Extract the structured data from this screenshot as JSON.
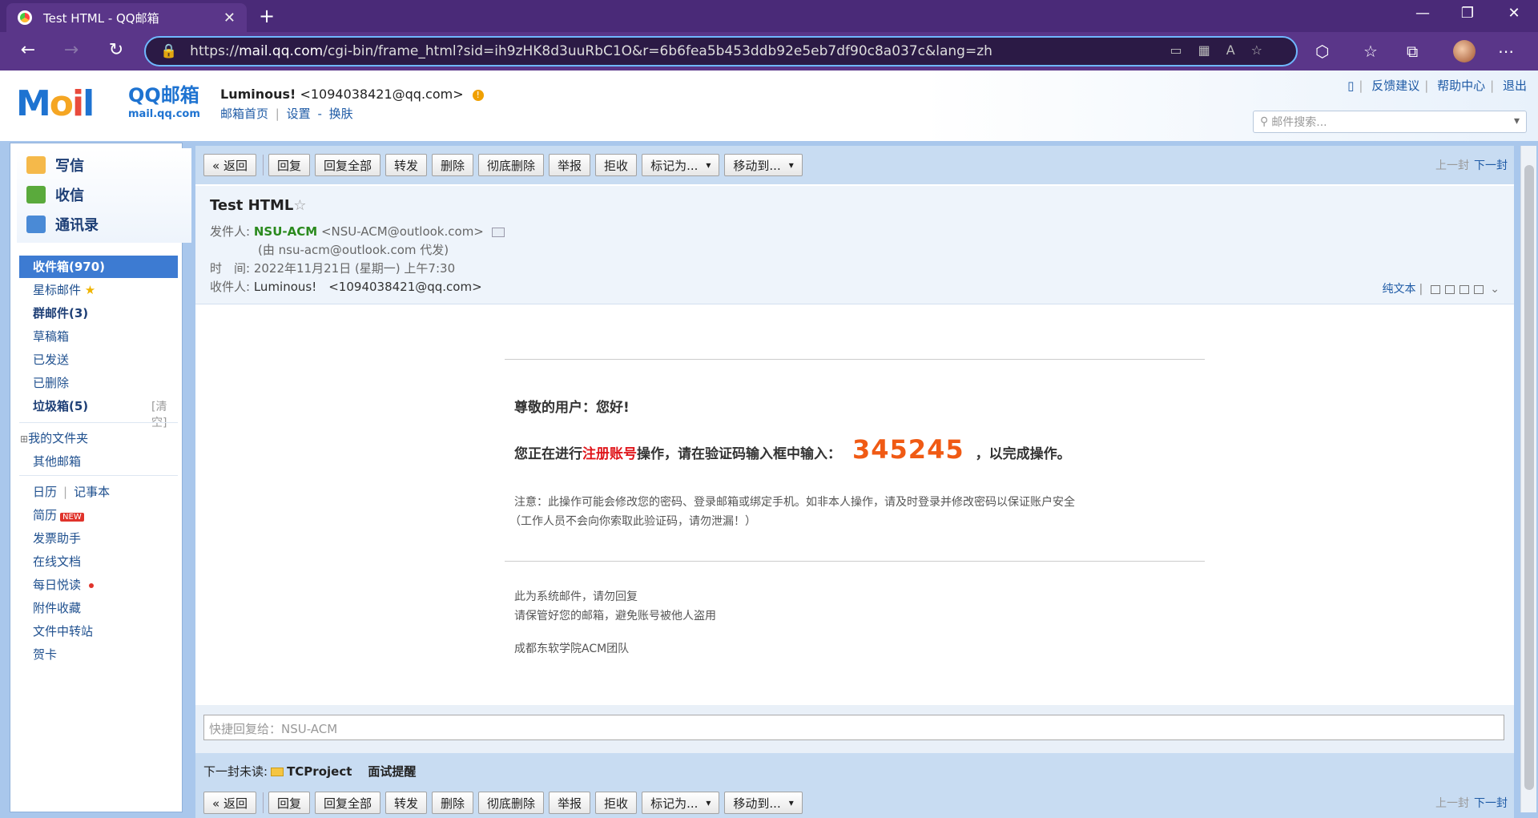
{
  "browser": {
    "tab_title": "Test HTML - QQ邮箱",
    "url_prefix": "https://",
    "url_host": "mail.qq.com",
    "url_path": "/cgi-bin/frame_html?sid=ih9zHK8d3uuRbC1O&r=6b6fea5b453ddb92e5eb7df90c8a037c&lang=zh"
  },
  "header": {
    "logo_text": "QQ邮箱",
    "logo_sub": "mail.qq.com",
    "user_name": "Luminous!",
    "user_email": "<1094038421@qq.com>",
    "links": [
      "邮箱首页",
      "|",
      "设置",
      "-",
      "换肤"
    ],
    "top_links": [
      "反馈建议",
      "帮助中心",
      "退出"
    ],
    "search_placeholder": "邮件搜索..."
  },
  "sidebar": {
    "compose": "写信",
    "inbox_main": "收信",
    "contacts": "通讯录",
    "inbox": "收件箱(970)",
    "starred": "星标邮件",
    "group": "群邮件(3)",
    "drafts": "草稿箱",
    "sent": "已发送",
    "deleted": "已删除",
    "spam": "垃圾箱(5)",
    "spam_clear": "[清空]",
    "my_folders": "我的文件夹",
    "other_mail": "其他邮箱",
    "calendar": "日历",
    "notebook": "记事本",
    "resume": "简历",
    "resume_badge": "NEW",
    "invoice": "发票助手",
    "docs": "在线文档",
    "daily": "每日悦读",
    "attachments": "附件收藏",
    "file_transfer": "文件中转站",
    "cards": "贺卡"
  },
  "toolbar": {
    "back": "« 返回",
    "reply": "回复",
    "reply_all": "回复全部",
    "forward": "转发",
    "delete": "删除",
    "delete_perm": "彻底删除",
    "report": "举报",
    "reject": "拒收",
    "mark_as": "标记为...",
    "move_to": "移动到...",
    "prev": "上一封",
    "next": "下一封"
  },
  "mail": {
    "subject": "Test HTML",
    "from_label": "发件人:",
    "from_name": "NSU-ACM",
    "from_email": "<NSU-ACM@outlook.com>",
    "sent_by": "(由 nsu-acm@outlook.com 代发)",
    "time_label": "时　间:",
    "time_value": "2022年11月21日 (星期一) 上午7:30",
    "to_label": "收件人:",
    "to_value": "Luminous!　<1094038421@qq.com>",
    "plain_text": "纯文本"
  },
  "body": {
    "greeting": "尊敬的用户：您好!",
    "line_pre": "您正在进行",
    "line_red": "注册账号",
    "line_mid": "操作，请在验证码输入框中输入：",
    "code": "345245",
    "line_post": "，以完成操作。",
    "note1": "注意：此操作可能会修改您的密码、登录邮箱或绑定手机。如非本人操作，请及时登录并修改密码以保证账户安全",
    "note2": "（工作人员不会向你索取此验证码，请勿泄漏！）",
    "sys1": "此为系统邮件，请勿回复",
    "sys2": "请保管好您的邮箱，避免账号被他人盗用",
    "team": "成都东软学院ACM团队"
  },
  "quick_reply": "快捷回复给：NSU-ACM",
  "next_unread": {
    "label": "下一封未读:",
    "sender": "TCProject",
    "subject": "面试提醒"
  }
}
